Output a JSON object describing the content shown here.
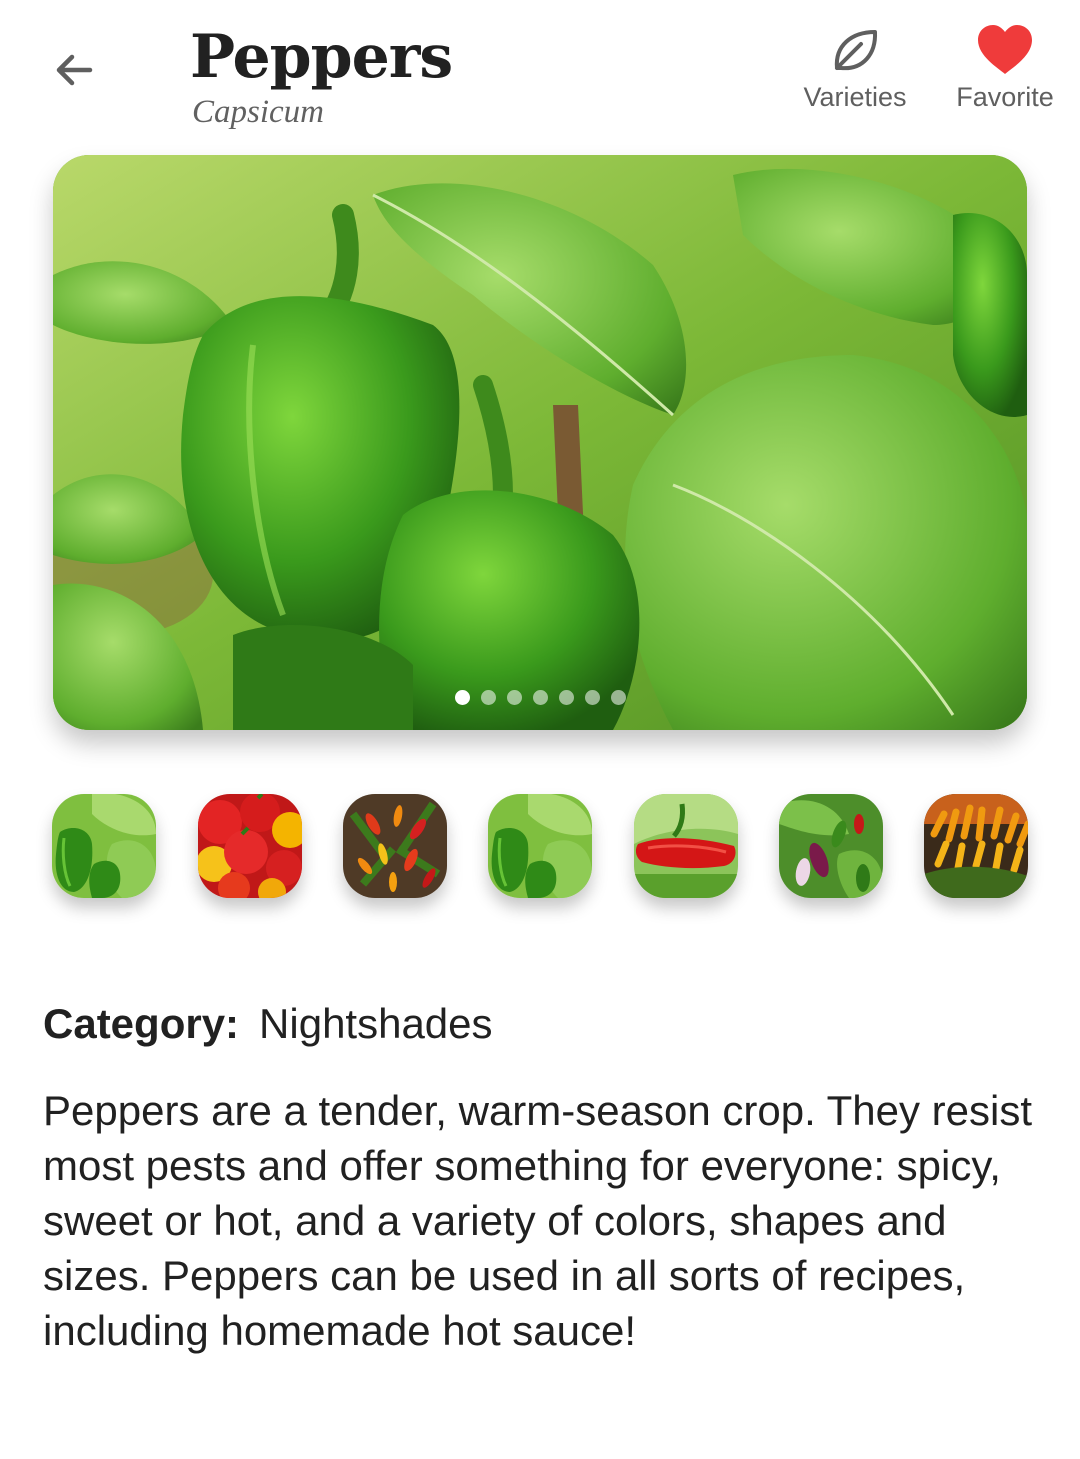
{
  "header": {
    "title": "Peppers",
    "subtitle": "Capsicum",
    "back_icon": "arrow-left-icon",
    "actions": [
      {
        "label": "Varieties",
        "icon": "leaf-icon",
        "color": "#5f5f5f"
      },
      {
        "label": "Favorite",
        "icon": "heart-icon",
        "color": "#ef3b3b"
      }
    ]
  },
  "gallery": {
    "image_count": 7,
    "active_index": 0,
    "thumbnails": [
      {
        "name": "green-bell-pepper-plant"
      },
      {
        "name": "red-yellow-bell-peppers"
      },
      {
        "name": "ornamental-chili-plant"
      },
      {
        "name": "green-bell-pepper-plant"
      },
      {
        "name": "red-chili-pepper"
      },
      {
        "name": "purple-chili-plant"
      },
      {
        "name": "orange-chili-peppers"
      }
    ]
  },
  "details": {
    "category_label": "Category:",
    "category_value": "Nightshades",
    "description": "Peppers are a tender, warm-season crop. They resist most pests and offer something for everyone: spicy, sweet or hot, and a variety of colors, shapes and sizes. Peppers can be used in all sorts of recipes, including homemade hot sauce!"
  }
}
